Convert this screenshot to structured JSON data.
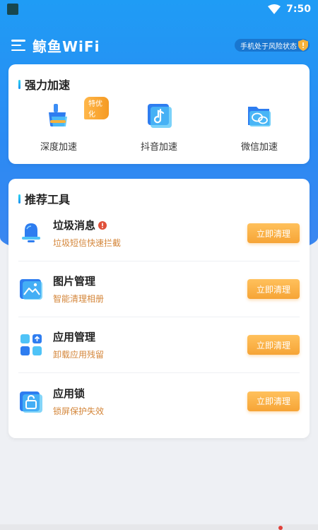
{
  "status_bar": {
    "time": "7:50"
  },
  "header": {
    "title": "鲸鱼WiFi",
    "risk_text": "手机处于风险状态"
  },
  "boost": {
    "title": "强力加速",
    "items": [
      {
        "label": "深度加速",
        "badge": "特优化",
        "icon": "broom-icon"
      },
      {
        "label": "抖音加速",
        "icon": "music-note-icon"
      },
      {
        "label": "微信加速",
        "icon": "chat-bubbles-icon"
      }
    ]
  },
  "tools": {
    "title": "推荐工具",
    "items": [
      {
        "name": "垃圾消息",
        "desc": "垃圾短信快速拦截",
        "button": "立即清理",
        "icon": "bell-icon",
        "warning": true
      },
      {
        "name": "图片管理",
        "desc": "智能清理相册",
        "button": "立即清理",
        "icon": "image-icon"
      },
      {
        "name": "应用管理",
        "desc": "卸载应用残留",
        "button": "立即清理",
        "icon": "app-grid-icon"
      },
      {
        "name": "应用锁",
        "desc": "锁屏保护失效",
        "button": "立即清理",
        "icon": "lock-icon"
      }
    ]
  },
  "colors": {
    "primary": "#2b8af3",
    "accent": "#f6a436",
    "desc_text": "#d4863a",
    "warning": "#e0503a"
  }
}
